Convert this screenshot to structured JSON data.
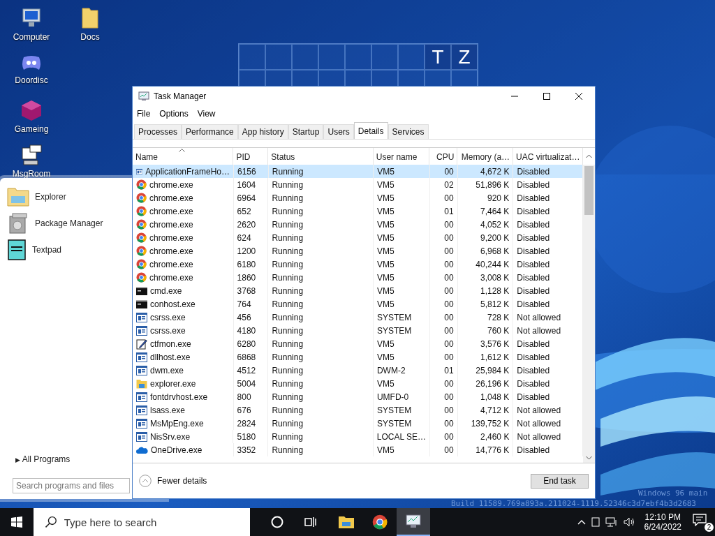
{
  "desktop_icons": [
    {
      "label": "Computer",
      "kind": "computer"
    },
    {
      "label": "Doordisc",
      "kind": "chat"
    },
    {
      "label": "Gameing",
      "kind": "cube"
    },
    {
      "label": "MsgRoom",
      "kind": "message"
    },
    {
      "label": "Docs",
      "kind": "folder"
    }
  ],
  "tile_letters": [
    {
      "text": "T"
    },
    {
      "text": "Z"
    }
  ],
  "build_info": [
    "Windows 96 main",
    "Build 11589.769a893a.211024-1119.52346c3d7ebf4b3d2683"
  ],
  "start_menu": {
    "items": [
      {
        "label": "Explorer",
        "kind": "folder"
      },
      {
        "label": "Package Manager",
        "kind": "package"
      },
      {
        "label": "Textpad",
        "kind": "notepad"
      }
    ],
    "all_programs": "All Programs",
    "all_programs_arrow": "▶",
    "search": {
      "placeholder": "Search programs and files"
    }
  },
  "task_manager": {
    "title": "Task Manager",
    "menu": [
      "File",
      "Options",
      "View"
    ],
    "tabs": [
      {
        "label": "Processes",
        "selected": false
      },
      {
        "label": "Performance",
        "selected": false
      },
      {
        "label": "App history",
        "selected": false
      },
      {
        "label": "Startup",
        "selected": false
      },
      {
        "label": "Users",
        "selected": false
      },
      {
        "label": "Details",
        "selected": true
      },
      {
        "label": "Services",
        "selected": false
      }
    ],
    "columns": [
      {
        "label": "Name",
        "sorted": true
      },
      {
        "label": "PID",
        "sorted": false
      },
      {
        "label": "Status",
        "sorted": false
      },
      {
        "label": "User name",
        "sorted": false
      },
      {
        "label": "CPU",
        "sorted": false
      },
      {
        "label": "Memory (a…",
        "sorted": false
      },
      {
        "label": "UAC virtualizat…",
        "sorted": false
      }
    ],
    "rows": [
      {
        "kind": "app",
        "name": "ApplicationFrameHo…",
        "pid": "6156",
        "status": "Running",
        "user": "VM5",
        "cpu": "00",
        "memory": "4,672 K",
        "uac": "Disabled",
        "selected": true
      },
      {
        "kind": "chrome",
        "name": "chrome.exe",
        "pid": "1604",
        "status": "Running",
        "user": "VM5",
        "cpu": "02",
        "memory": "51,896 K",
        "uac": "Disabled",
        "selected": false
      },
      {
        "kind": "chrome",
        "name": "chrome.exe",
        "pid": "6964",
        "status": "Running",
        "user": "VM5",
        "cpu": "00",
        "memory": "920 K",
        "uac": "Disabled",
        "selected": false
      },
      {
        "kind": "chrome",
        "name": "chrome.exe",
        "pid": "652",
        "status": "Running",
        "user": "VM5",
        "cpu": "01",
        "memory": "7,464 K",
        "uac": "Disabled",
        "selected": false
      },
      {
        "kind": "chrome",
        "name": "chrome.exe",
        "pid": "2620",
        "status": "Running",
        "user": "VM5",
        "cpu": "00",
        "memory": "4,052 K",
        "uac": "Disabled",
        "selected": false
      },
      {
        "kind": "chrome",
        "name": "chrome.exe",
        "pid": "624",
        "status": "Running",
        "user": "VM5",
        "cpu": "00",
        "memory": "9,200 K",
        "uac": "Disabled",
        "selected": false
      },
      {
        "kind": "chrome",
        "name": "chrome.exe",
        "pid": "1200",
        "status": "Running",
        "user": "VM5",
        "cpu": "00",
        "memory": "6,968 K",
        "uac": "Disabled",
        "selected": false
      },
      {
        "kind": "chrome",
        "name": "chrome.exe",
        "pid": "6180",
        "status": "Running",
        "user": "VM5",
        "cpu": "00",
        "memory": "40,244 K",
        "uac": "Disabled",
        "selected": false
      },
      {
        "kind": "chrome",
        "name": "chrome.exe",
        "pid": "1860",
        "status": "Running",
        "user": "VM5",
        "cpu": "00",
        "memory": "3,008 K",
        "uac": "Disabled",
        "selected": false
      },
      {
        "kind": "console",
        "name": "cmd.exe",
        "pid": "3768",
        "status": "Running",
        "user": "VM5",
        "cpu": "00",
        "memory": "1,128 K",
        "uac": "Disabled",
        "selected": false
      },
      {
        "kind": "console",
        "name": "conhost.exe",
        "pid": "764",
        "status": "Running",
        "user": "VM5",
        "cpu": "00",
        "memory": "5,812 K",
        "uac": "Disabled",
        "selected": false
      },
      {
        "kind": "app",
        "name": "csrss.exe",
        "pid": "456",
        "status": "Running",
        "user": "SYSTEM",
        "cpu": "00",
        "memory": "728 K",
        "uac": "Not allowed",
        "selected": false
      },
      {
        "kind": "app",
        "name": "csrss.exe",
        "pid": "4180",
        "status": "Running",
        "user": "SYSTEM",
        "cpu": "00",
        "memory": "760 K",
        "uac": "Not allowed",
        "selected": false
      },
      {
        "kind": "edit",
        "name": "ctfmon.exe",
        "pid": "6280",
        "status": "Running",
        "user": "VM5",
        "cpu": "00",
        "memory": "3,576 K",
        "uac": "Disabled",
        "selected": false
      },
      {
        "kind": "app",
        "name": "dllhost.exe",
        "pid": "6868",
        "status": "Running",
        "user": "VM5",
        "cpu": "00",
        "memory": "1,612 K",
        "uac": "Disabled",
        "selected": false
      },
      {
        "kind": "app",
        "name": "dwm.exe",
        "pid": "4512",
        "status": "Running",
        "user": "DWM-2",
        "cpu": "01",
        "memory": "25,984 K",
        "uac": "Disabled",
        "selected": false
      },
      {
        "kind": "folder",
        "name": "explorer.exe",
        "pid": "5004",
        "status": "Running",
        "user": "VM5",
        "cpu": "00",
        "memory": "26,196 K",
        "uac": "Disabled",
        "selected": false
      },
      {
        "kind": "app",
        "name": "fontdrvhost.exe",
        "pid": "800",
        "status": "Running",
        "user": "UMFD-0",
        "cpu": "00",
        "memory": "1,048 K",
        "uac": "Disabled",
        "selected": false
      },
      {
        "kind": "app",
        "name": "lsass.exe",
        "pid": "676",
        "status": "Running",
        "user": "SYSTEM",
        "cpu": "00",
        "memory": "4,712 K",
        "uac": "Not allowed",
        "selected": false
      },
      {
        "kind": "app",
        "name": "MsMpEng.exe",
        "pid": "2824",
        "status": "Running",
        "user": "SYSTEM",
        "cpu": "00",
        "memory": "139,752 K",
        "uac": "Not allowed",
        "selected": false
      },
      {
        "kind": "app",
        "name": "NisSrv.exe",
        "pid": "5180",
        "status": "Running",
        "user": "LOCAL SE…",
        "cpu": "00",
        "memory": "2,460 K",
        "uac": "Not allowed",
        "selected": false
      },
      {
        "kind": "cloud",
        "name": "OneDrive.exe",
        "pid": "3352",
        "status": "Running",
        "user": "VM5",
        "cpu": "00",
        "memory": "14,776 K",
        "uac": "Disabled",
        "selected": false
      }
    ],
    "fewer_details": "Fewer details",
    "end_task": "End task"
  },
  "taskbar": {
    "search": {
      "placeholder": "Type here to search"
    },
    "apps": [
      {
        "kind": "folder",
        "active": false
      },
      {
        "kind": "chrome",
        "active": false
      },
      {
        "kind": "taskmgr",
        "active": true
      }
    ],
    "time": "12:10 PM",
    "date": "6/24/2022",
    "notifications": "2"
  }
}
